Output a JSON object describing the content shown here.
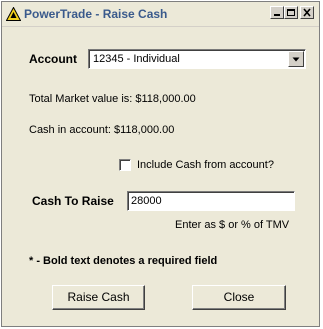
{
  "window": {
    "title": "PowerTrade - Raise Cash",
    "icon": "powertrade-a-icon",
    "controls": [
      "minimize-icon",
      "maximize-icon",
      "close-icon"
    ]
  },
  "account": {
    "label": "Account",
    "selected": "12345 - Individual"
  },
  "info": {
    "total_market_value": "Total Market value is: $118,000.00",
    "cash_in_account": "Cash in account: $118,000.00"
  },
  "include_cash": {
    "label": "Include Cash from account?",
    "checked": false
  },
  "cash_to_raise": {
    "label": "Cash To Raise",
    "value": "28000",
    "hint": "Enter as $ or % of TMV"
  },
  "note": "* - Bold text denotes a required field",
  "buttons": {
    "raise_cash": "Raise Cash",
    "close": "Close"
  },
  "colors": {
    "dialog_bg": "#ece9d8",
    "title_text": "#3a5a8c",
    "icon_yellow": "#f2d21b"
  }
}
